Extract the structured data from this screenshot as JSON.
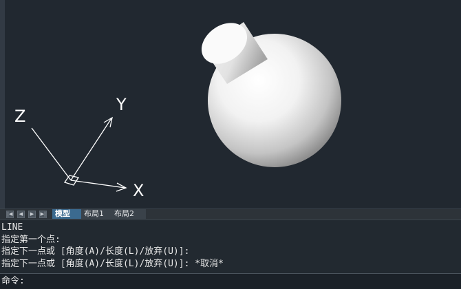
{
  "viewport": {
    "background": "#212830",
    "axes": {
      "x_label": "X",
      "y_label": "Y",
      "z_label": "Z"
    }
  },
  "layout_tabs": {
    "nav_icons": [
      "first-icon",
      "prev-icon",
      "next-icon",
      "last-icon"
    ],
    "tabs": [
      {
        "label": "模型",
        "active": true
      },
      {
        "label": "布局1",
        "active": false
      },
      {
        "label": "布局2",
        "active": false
      }
    ]
  },
  "command_history": {
    "lines": [
      "LINE",
      "指定第一个点:",
      "指定下一点或 [角度(A)/长度(L)/放弃(U)]:",
      "指定下一点或 [角度(A)/长度(L)/放弃(U)]: *取消*"
    ]
  },
  "command_line": {
    "prompt": "命令:"
  }
}
